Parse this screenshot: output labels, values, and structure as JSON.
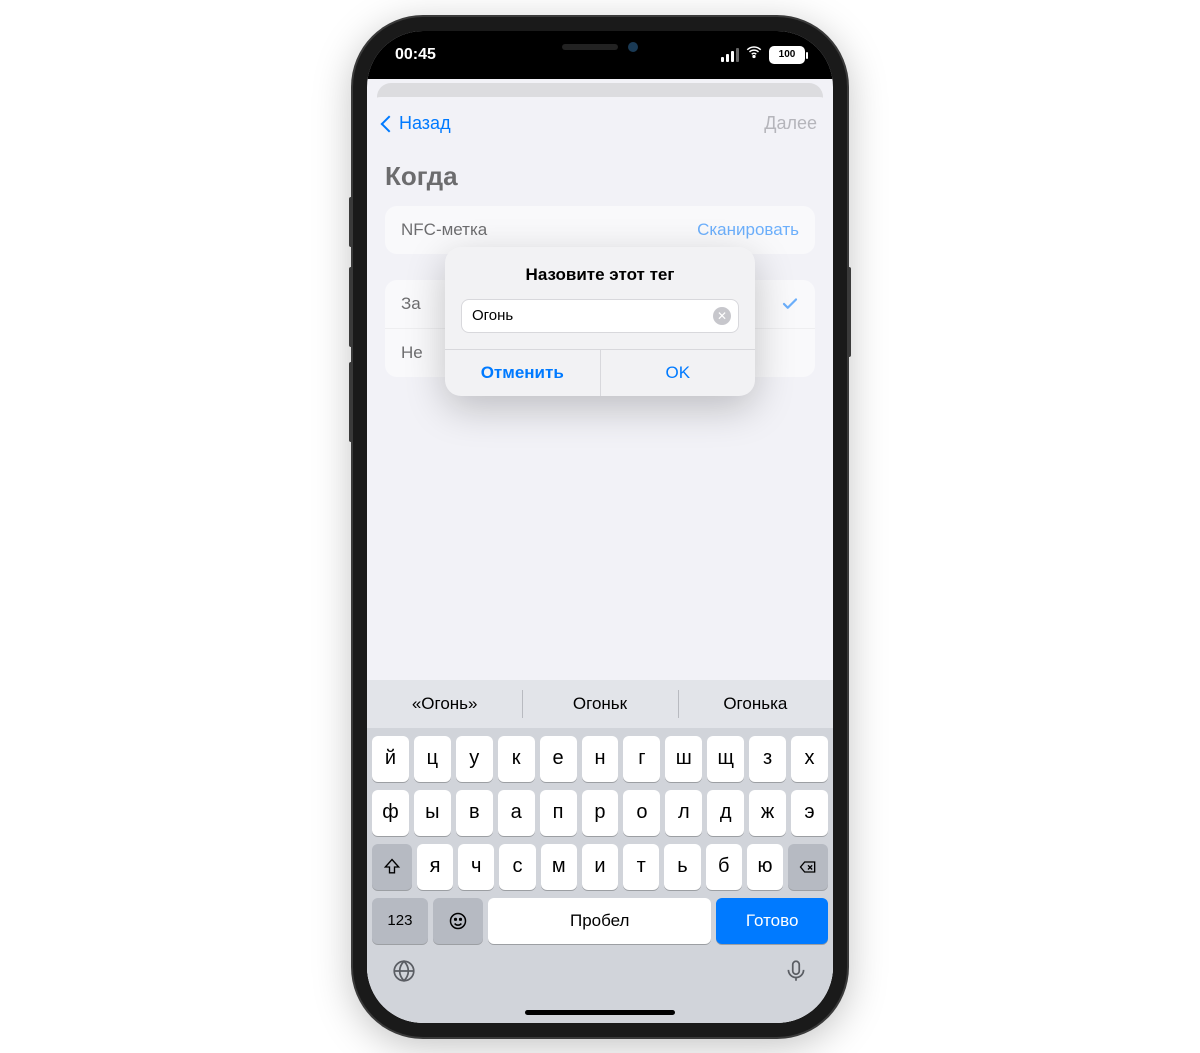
{
  "status": {
    "time": "00:45",
    "battery": "100"
  },
  "nav": {
    "back": "Назад",
    "next": "Далее"
  },
  "section_title": "Когда",
  "rows": {
    "nfc_label": "NFC-метка",
    "nfc_action": "Сканировать",
    "ask_label": "За",
    "never_label": "Не"
  },
  "alert": {
    "title": "Назовите этот тег",
    "value": "Огонь",
    "cancel": "Отменить",
    "ok": "OK"
  },
  "suggestions": [
    "«Огонь»",
    "Огоньк",
    "Огонька"
  ],
  "keyboard": {
    "row1": [
      "й",
      "ц",
      "у",
      "к",
      "е",
      "н",
      "г",
      "ш",
      "щ",
      "з",
      "х"
    ],
    "row2": [
      "ф",
      "ы",
      "в",
      "а",
      "п",
      "р",
      "о",
      "л",
      "д",
      "ж",
      "э"
    ],
    "row3": [
      "я",
      "ч",
      "с",
      "м",
      "и",
      "т",
      "ь",
      "б",
      "ю"
    ],
    "num": "123",
    "space": "Пробел",
    "done": "Готово"
  }
}
